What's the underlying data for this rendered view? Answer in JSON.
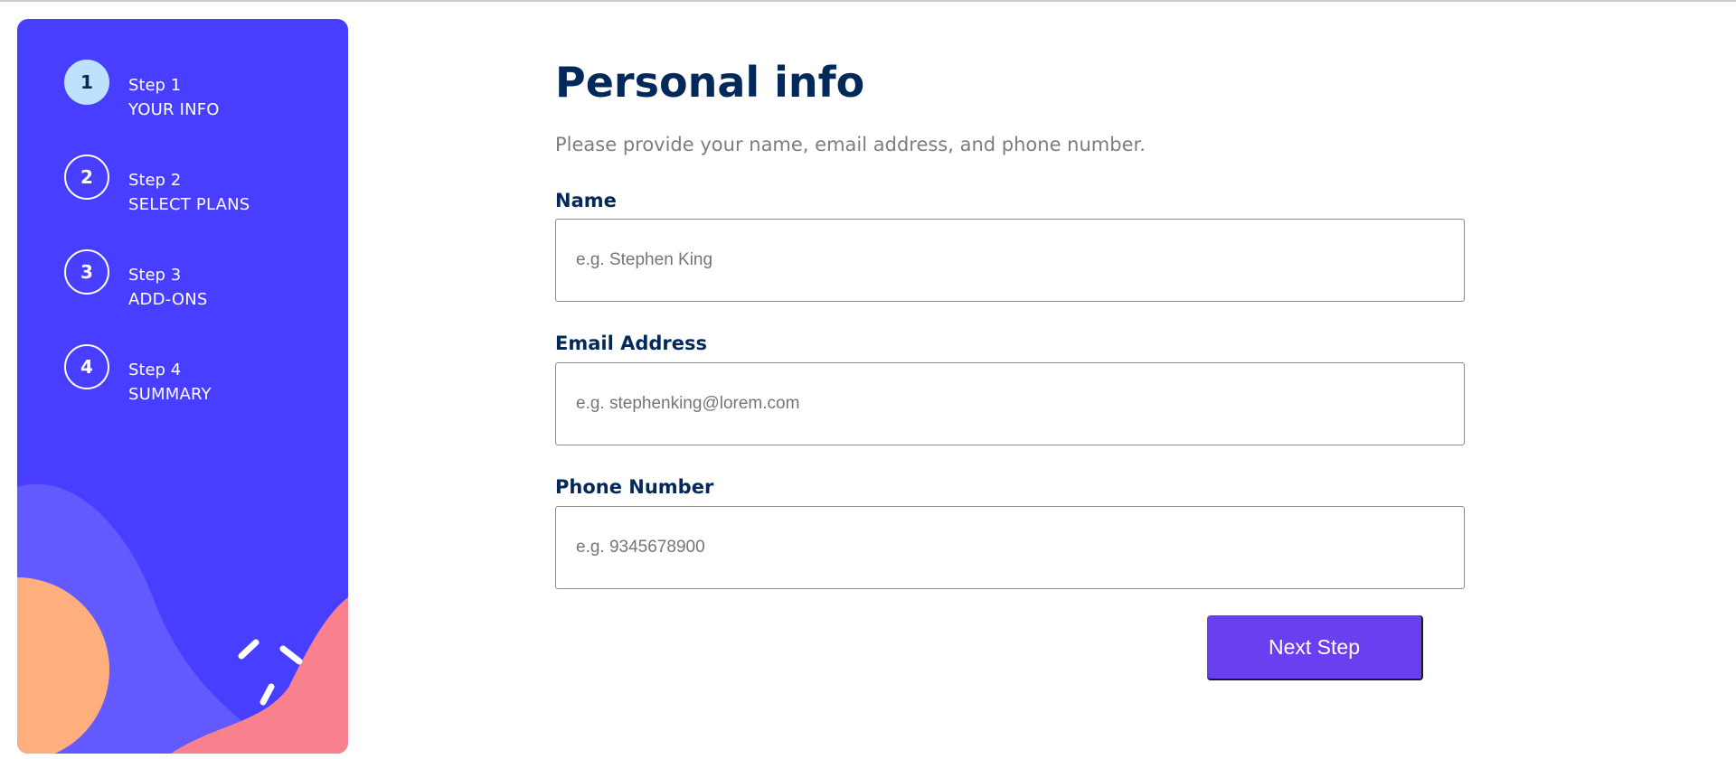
{
  "sidebar": {
    "steps": [
      {
        "number": "1",
        "label": "Step 1",
        "name": "YOUR INFO",
        "active": true
      },
      {
        "number": "2",
        "label": "Step 2",
        "name": "SELECT PLANS",
        "active": false
      },
      {
        "number": "3",
        "label": "Step 3",
        "name": "ADD-ONS",
        "active": false
      },
      {
        "number": "4",
        "label": "Step 4",
        "name": "SUMMARY",
        "active": false
      }
    ]
  },
  "main": {
    "title": "Personal info",
    "subtitle": "Please provide your name, email address, and phone number.",
    "fields": [
      {
        "label": "Name",
        "value": "",
        "placeholder": "e.g. Stephen King"
      },
      {
        "label": "Email Address",
        "value": "",
        "placeholder": "e.g. stephenking@lorem.com"
      },
      {
        "label": "Phone Number",
        "value": "",
        "placeholder": "e.g. 9345678900"
      }
    ],
    "next_label": "Next Step"
  },
  "colors": {
    "sidebar_bg": "#483eff",
    "active_step": "#bee2fd",
    "title": "#02295a",
    "subtitle": "#7d7c83",
    "button": "#6a3ff0",
    "decor_orange": "#ffaf7e",
    "decor_pink": "#f9818e",
    "decor_violet": "#6259ff"
  }
}
